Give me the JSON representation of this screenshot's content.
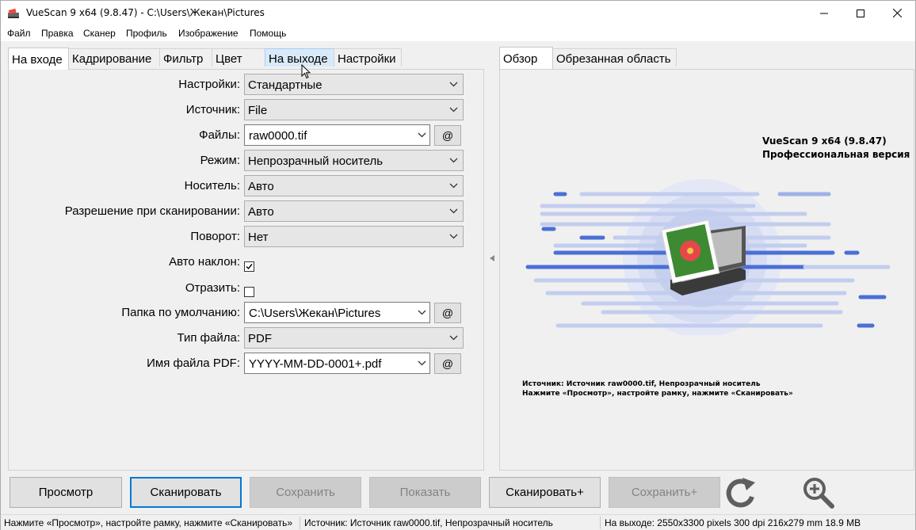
{
  "window": {
    "title": "VueScan 9 x64 (9.8.47) - C:\\Users\\Жекан\\Pictures",
    "minimize_icon": "minimize-icon",
    "maximize_icon": "maximize-icon",
    "close_icon": "close-icon"
  },
  "menu": [
    "Файл",
    "Правка",
    "Сканер",
    "Профиль",
    "Изображение",
    "Помощь"
  ],
  "left_tabs": [
    "На входе",
    "Кадрирование",
    "Фильтр",
    "Цвет",
    "На выходе",
    "Настройки"
  ],
  "right_tabs": [
    "Обзор",
    "Обрезанная область"
  ],
  "form": {
    "settings": {
      "label": "Настройки:",
      "value": "Стандартные"
    },
    "source": {
      "label": "Источник:",
      "value": "File"
    },
    "files": {
      "label": "Файлы:",
      "value": "raw0000.tif",
      "at": "@"
    },
    "mode": {
      "label": "Режим:",
      "value": "Непрозрачный носитель"
    },
    "media": {
      "label": "Носитель:",
      "value": "Авто"
    },
    "resolution": {
      "label": "Разрешение при сканировании:",
      "value": "Авто"
    },
    "rotation": {
      "label": "Поворот:",
      "value": "Нет"
    },
    "auto_skew": {
      "label": "Авто наклон:",
      "checked": true
    },
    "mirror": {
      "label": "Отразить:",
      "checked": false
    },
    "default_folder": {
      "label": "Папка по умолчанию:",
      "value": "C:\\Users\\Жекан\\Pictures",
      "at": "@"
    },
    "file_type": {
      "label": "Тип файла:",
      "value": "PDF"
    },
    "pdf_name": {
      "label": "Имя файла PDF:",
      "value": "YYYY-MM-DD-0001+.pdf",
      "at": "@"
    }
  },
  "preview": {
    "title_line1": "VueScan 9 x64 (9.8.47)",
    "title_line2": "Профессиональная версия",
    "info_line1": "Источник: Источник raw0000.tif, Непрозрачный носитель",
    "info_line2": "Нажмите «Просмотр», настройте рамку, нажмите «Сканировать»",
    "illustration": "scanner-illustration"
  },
  "buttons": {
    "preview": "Просмотр",
    "scan": "Сканировать",
    "save": "Сохранить",
    "show": "Показать",
    "scan_plus": "Сканировать+",
    "save_plus": "Сохранить+",
    "rotate_icon": "rotate-icon",
    "zoom_icon": "zoom-in-icon"
  },
  "status": {
    "hint": "Нажмите «Просмотр», настройте рамку, нажмите «Сканировать»",
    "source": "Источник: Источник raw0000.tif, Непрозрачный носитель",
    "output": "На выходе: 2550x3300 pixels 300 dpi 216x279 mm 18.9 MB"
  },
  "colors": {
    "accent": "#0078d7",
    "illustration_blue": "#4a6fd6"
  }
}
